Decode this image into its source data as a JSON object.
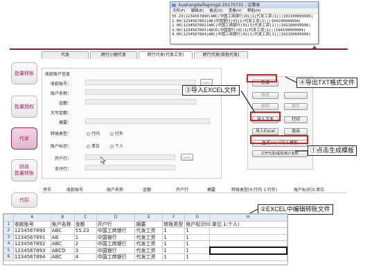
{
  "notepad": {
    "title": "kuahangdaifagongzi-20170731 - 记事本",
    "menu": [
      "文件(F)",
      "编辑(E)",
      "格式(O)",
      "查看(V)",
      "帮助(H)"
    ],
    "lines": [
      "55.23|1234567890|ABC|中国工商银行|01|1|代发工资|1|||102100099996|",
      "1.00|1234567891|AB|中国银行|01|1|代发工资|1|||104100000004|",
      "2.00|1234567892|ABC|中国工商银行|01|1|代发工资|1|||102100099996|",
      "3.00|1234567893|ABCD|中国银行|01|1|代发工资|1|||104100000004|",
      "4.00|1234567894|ABC|中国工商银行|01|1|代发工资|1|||102100099996|"
    ]
  },
  "sidebar": [
    "批量转账",
    "批量授权",
    "代发",
    "财政\n批量转账",
    "代扣"
  ],
  "tabs": [
    "代发",
    "跨行小额代发",
    "跨行代发(代发工资)",
    "跨行代发(其他代发)"
  ],
  "form": {
    "section_title": "收款账户信息",
    "labels": [
      "收款账号：",
      "账户名称：",
      "金额：",
      "大写金额：",
      "摘要：",
      "转账类型：",
      "账户标识：",
      "开户行：",
      "支付行："
    ],
    "transfer_type_options": [
      "行内",
      "行外"
    ],
    "account_flag_options": [
      "单位",
      "个人"
    ],
    "browse": "...."
  },
  "buttons": {
    "add": "新增",
    "modify": "修改",
    "delete": "删除",
    "save": "保存",
    "import_text": "导入文本",
    "print": "打印",
    "import_excel": "导入Excel",
    "exit": "退出",
    "generate_template": "生成excel导入模板",
    "open_bank": "打开代发/提现/账户名称"
  },
  "list_headers": [
    "序号",
    "收款账号",
    "账户名称",
    "金额",
    "开户行",
    "摘要",
    "转账类型(0:行内 1:行外)",
    "账户标识(0:单位"
  ],
  "sheet": {
    "col_letters": [
      "",
      "A",
      "B",
      "C",
      "D",
      "E",
      "F",
      "G",
      "H"
    ],
    "rows": [
      [
        "1",
        "收款账号",
        "账户名称",
        "金额",
        "开户行",
        "摘要",
        "转账类型",
        "账户标识(0:单位 1:个人)",
        ""
      ],
      [
        "2",
        "1234567890",
        "ABC",
        "55.23",
        "中国工商银行",
        "代发工资",
        "1",
        "1",
        ""
      ],
      [
        "3",
        "1234567891",
        "AB",
        "1",
        "中国银行",
        "代发工资",
        "1",
        "1",
        ""
      ],
      [
        "4",
        "1234567892",
        "ABC",
        "2",
        "中国工商银行",
        "代发工资",
        "1",
        "1",
        ""
      ],
      [
        "5",
        "1234567893",
        "ABCD",
        "3",
        "中国银行",
        "代发工资",
        "1",
        "1",
        ""
      ],
      [
        "6",
        "1234567894",
        "ABC",
        "4",
        "中国工商银行",
        "代发工资",
        "1",
        "1",
        ""
      ]
    ]
  },
  "callouts": {
    "c1": "①点击生成模板",
    "c2": "②EXCEL中编辑转账文件",
    "c3": "③导入EXCEL文件",
    "c4": "④导出TXT格式文件"
  },
  "colors": {
    "accent": "#a0225f",
    "callout_red": "#d21f1f",
    "arrow": "#c0152a"
  }
}
